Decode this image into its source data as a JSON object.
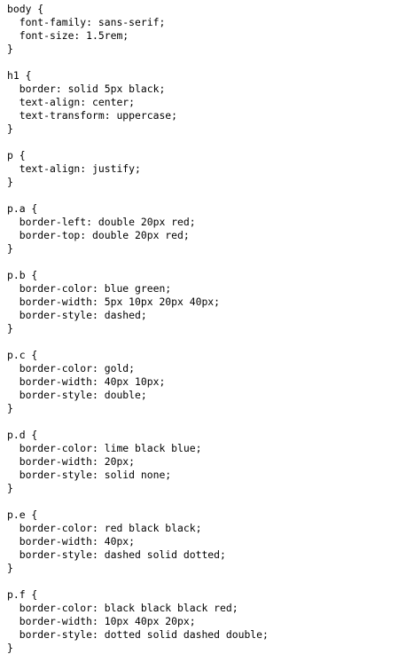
{
  "code": {
    "lines": [
      "body {",
      "  font-family: sans-serif;",
      "  font-size: 1.5rem;",
      "}",
      "",
      "h1 {",
      "  border: solid 5px black;",
      "  text-align: center;",
      "  text-transform: uppercase;",
      "}",
      "",
      "p {",
      "  text-align: justify;",
      "}",
      "",
      "p.a {",
      "  border-left: double 20px red;",
      "  border-top: double 20px red;",
      "}",
      "",
      "p.b {",
      "  border-color: blue green;",
      "  border-width: 5px 10px 20px 40px;",
      "  border-style: dashed;",
      "}",
      "",
      "p.c {",
      "  border-color: gold;",
      "  border-width: 40px 10px;",
      "  border-style: double;",
      "}",
      "",
      "p.d {",
      "  border-color: lime black blue;",
      "  border-width: 20px;",
      "  border-style: solid none;",
      "}",
      "",
      "p.e {",
      "  border-color: red black black;",
      "  border-width: 40px;",
      "  border-style: dashed solid dotted;",
      "}",
      "",
      "p.f {",
      "  border-color: black black black red;",
      "  border-width: 10px 40px 20px;",
      "  border-style: dotted solid dashed double;",
      "}"
    ]
  }
}
